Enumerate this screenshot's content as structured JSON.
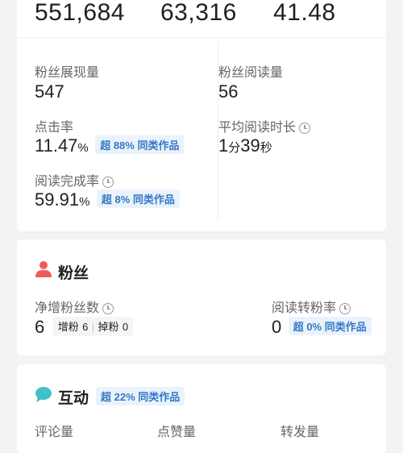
{
  "top_stats": [
    "551,684",
    "63,316",
    "41.48"
  ],
  "metrics": {
    "fan_impressions": {
      "label": "粉丝展现量",
      "value": "547"
    },
    "fan_reads": {
      "label": "粉丝阅读量",
      "value": "56"
    },
    "ctr": {
      "label": "点击率",
      "value": "11.47",
      "unit": "%",
      "badge": "超 88% 同类作品"
    },
    "avg_read_time": {
      "label": "平均阅读时长",
      "value_min": "1",
      "unit_min": "分",
      "value_sec": "39",
      "unit_sec": "秒"
    },
    "completion_rate": {
      "label": "阅读完成率",
      "value": "59.91",
      "unit": "%",
      "badge": "超 8% 同类作品"
    }
  },
  "fans": {
    "title": "粉丝",
    "net_growth": {
      "label": "净增粉丝数",
      "value": "6",
      "gain_label": "增粉",
      "gain_value": "6",
      "loss_label": "掉粉",
      "loss_value": "0"
    },
    "conversion": {
      "label": "阅读转粉率",
      "value": "0",
      "badge": "超 0% 同类作品"
    }
  },
  "interaction": {
    "title": "互动",
    "badge": "超 22% 同类作品",
    "columns": [
      "评论量",
      "点赞量",
      "转发量"
    ]
  },
  "colors": {
    "badge_text": "#3478c8",
    "badge_bg": "#eaf3fb",
    "fans_icon": "#ef5b5b",
    "interaction_icon": "#3fc1c9"
  }
}
